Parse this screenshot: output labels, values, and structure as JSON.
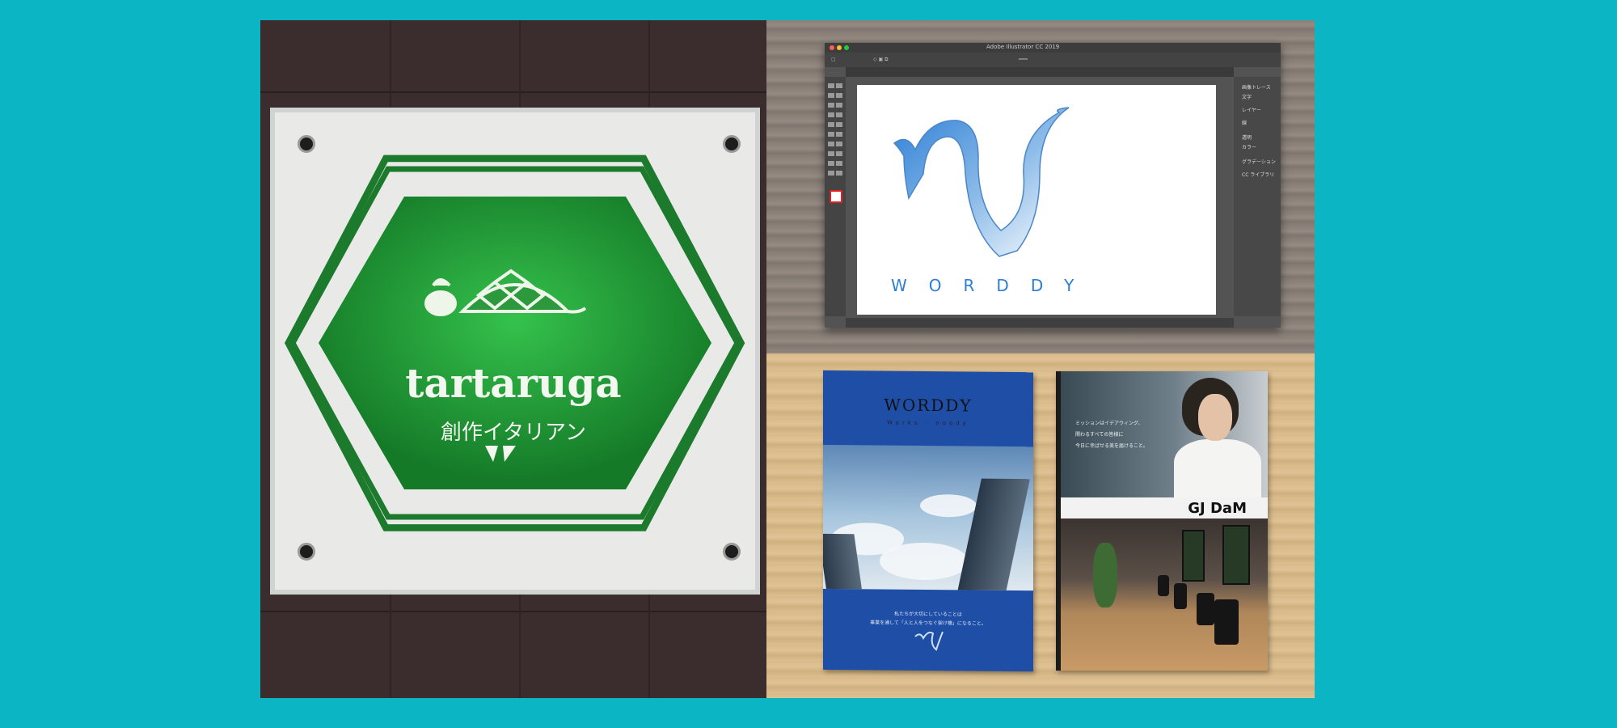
{
  "sign": {
    "name": "tartaruga",
    "subtitle": "創作イタリアン",
    "colors": {
      "green": "#1c7a2c",
      "plate": "#e9eae8"
    }
  },
  "illustrator": {
    "app_title": "Adobe Illustrator CC 2019",
    "artboard_word": "WORDDY",
    "accent": "#2c7ed6",
    "panels": [
      "画像トレース",
      "文字",
      "レイヤー",
      "線",
      "透明",
      "カラー",
      "グラデーション",
      "CC ライブラリ"
    ]
  },
  "brochure_a": {
    "title": "WORDDY",
    "subtitle": "Works · noody",
    "body_line1": "私たちが大切にしていることは",
    "body_line2": "事業を通して「人と人をつなぐ架け橋」になること。"
  },
  "brochure_b": {
    "logo": "GJ DaM",
    "copy_line1": "ミッションはイデアウィング、",
    "copy_line2": "関わるすべての皆様に",
    "copy_line3": "今日に幸ばせる美を届けること。"
  }
}
